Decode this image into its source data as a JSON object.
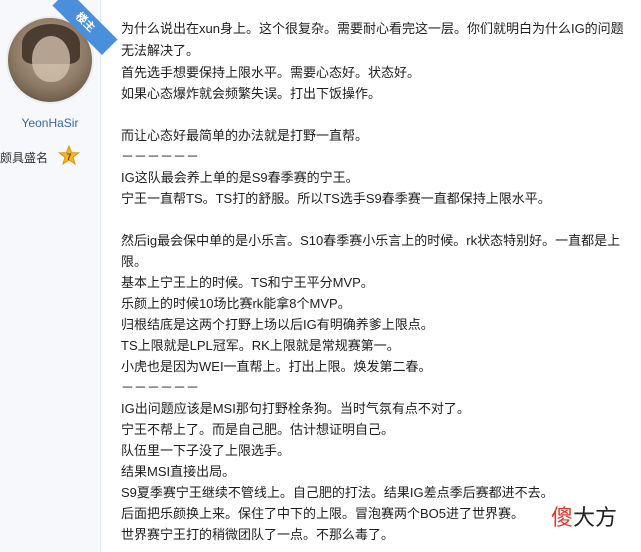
{
  "sidebar": {
    "corner_tag": "楼主",
    "username": "YeonHaSir",
    "title_label": "颇具盛名",
    "level_badge": "7"
  },
  "post": {
    "lines": [
      "为什么说出在xun身上。这个很复杂。需要耐心看完这一层。你们就明白为什么IG的问题无法解决了。",
      "首先选手想要保持上限水平。需要心态好。状态好。",
      "如果心态爆炸就会频繁失误。打出下饭操作。",
      "",
      "而让心态好最简单的办法就是打野一直帮。",
      "－－－－－－",
      "IG这队最会养上单的是S9春季赛的宁王。",
      "宁王一直帮TS。TS打的舒服。所以TS选手S9春季赛一直都保持上限水平。",
      "",
      "然后ig最会保中单的是小乐言。S10春季赛小乐言上的时候。rk状态特别好。一直都是上限。",
      "基本上宁王上的时候。TS和宁王平分MVP。",
      "乐颜上的时候10场比赛rk能拿8个MVP。",
      "归根结底是这两个打野上场以后IG有明确养爹上限点。",
      "TS上限就是LPL冠军。RK上限就是常规赛第一。",
      "小虎也是因为WEI一直帮上。打出上限。焕发第二春。",
      "－－－－－－",
      "IG出问题应该是MSI那句打野栓条狗。当时气氛有点不对了。",
      "宁王不帮上了。而是自己肥。估计想证明自己。",
      "队伍里一下子没了上限选手。",
      "结果MSI直接出局。",
      "S9夏季赛宁王继续不管线上。自己肥的打法。结果IG差点季后赛都进不去。",
      "后面把乐颜换上来。保住了中下的上限。冒泡赛两个BO5进了世界赛。",
      "世界赛宁王打的稍微团队了一点。不那么毒了。"
    ]
  },
  "watermark": {
    "char1": "傻",
    "rest": "大方"
  }
}
